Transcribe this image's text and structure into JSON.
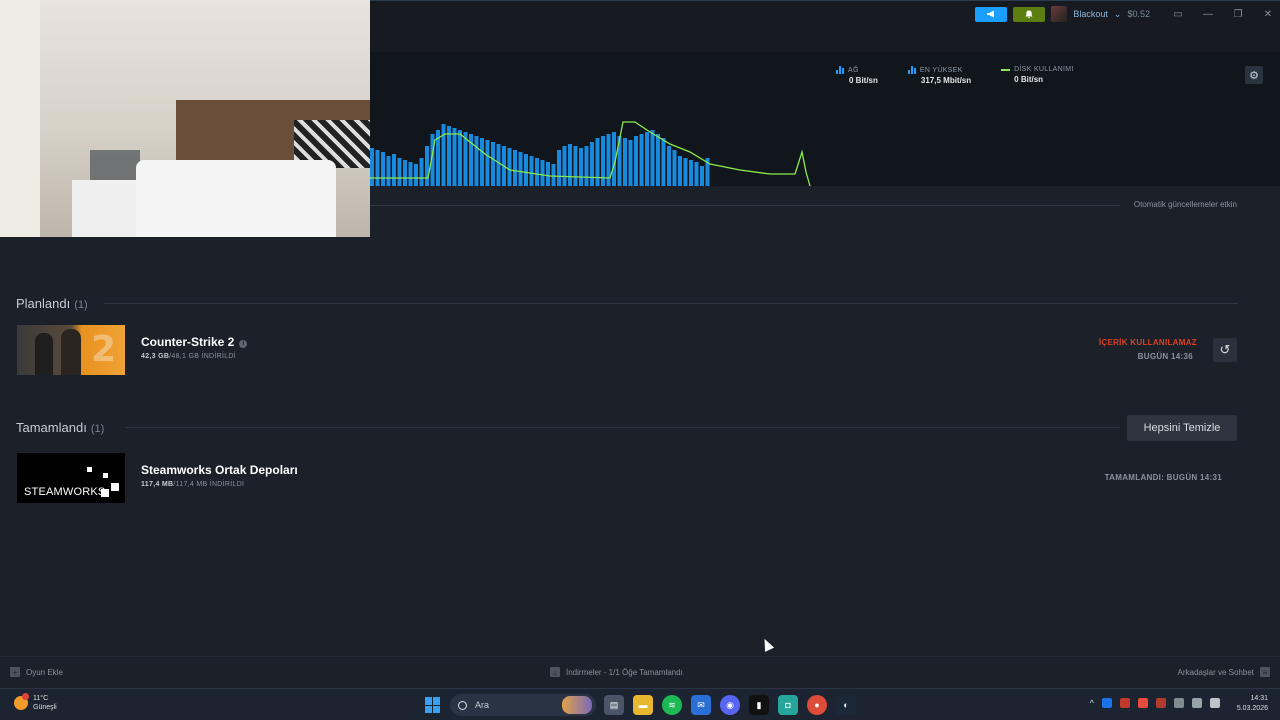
{
  "window": {
    "user_name": "Blackout",
    "balance": "$0.52"
  },
  "graph": {
    "network_label": "AĞ",
    "network_value": "0 Bit/sn",
    "peak_label": "EN YÜKSEK",
    "peak_value": "317,5 Mbit/sn",
    "disk_label": "DİSK KULLANIMI",
    "disk_value": "0 Bit/sn",
    "colors": {
      "network": "#1a9fff",
      "disk": "#8bea4b"
    }
  },
  "auto_updates": "Otomatik güncellemeler etkin",
  "scheduled": {
    "title": "Planlandı",
    "count": "(1)",
    "item": {
      "name": "Counter-Strike 2",
      "size_done": "42,3 GB",
      "size_total": "/48,1 GB İNDİRİLDİ",
      "status": "İÇERİK KULLANILAMAZ",
      "time": "BUGÜN 14:36"
    }
  },
  "completed": {
    "title": "Tamamlandı",
    "count": "(1)",
    "clear_all": "Hepsini Temizle",
    "item": {
      "name": "Steamworks Ortak Depoları",
      "logo": "STEAMWORKS",
      "size_done": "117,4 MB",
      "size_total": "/117,4 MB İNDİRİLDİ",
      "time": "TAMAMLANDI: BUGÜN 14:31"
    }
  },
  "footer": {
    "add_game": "Oyun Ekle",
    "downloads": "İndirmeler - 1/1 Öğe Tamamlandı",
    "friends": "Arkadaşlar ve Sohbet"
  },
  "taskbar": {
    "temperature": "11°C",
    "weather": "Güneşli",
    "search_placeholder": "Ara",
    "time": "14:31",
    "date": "5.03.2026"
  }
}
